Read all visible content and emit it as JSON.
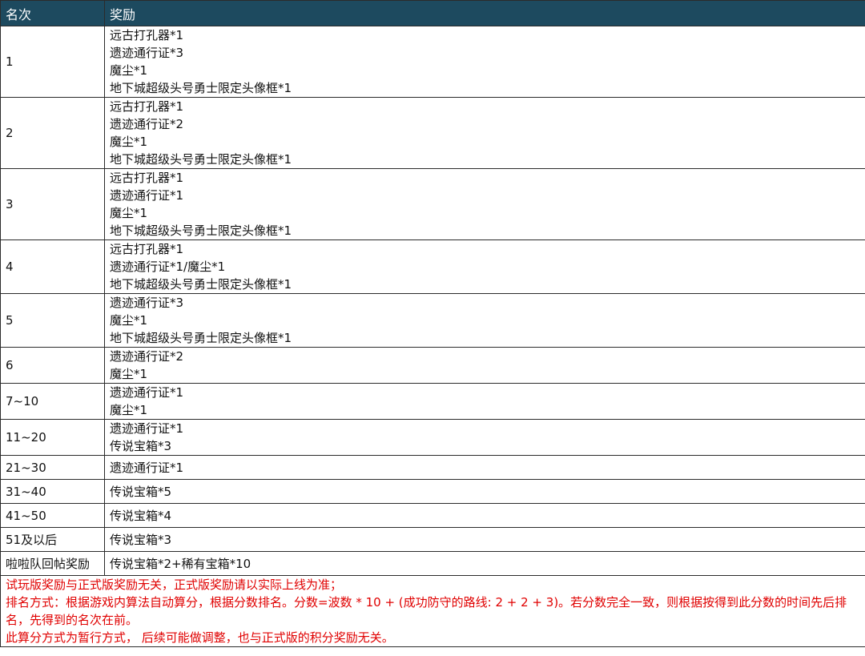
{
  "table": {
    "headers": {
      "rank": "名次",
      "reward": "奖励"
    },
    "rows": [
      {
        "rank": "1",
        "rewards": [
          "远古打孔器*1",
          "遗迹通行证*3",
          "魔尘*1",
          "地下城超级头号勇士限定头像框*1"
        ]
      },
      {
        "rank": "2",
        "rewards": [
          "远古打孔器*1",
          "遗迹通行证*2",
          "魔尘*1",
          "地下城超级头号勇士限定头像框*1"
        ]
      },
      {
        "rank": "3",
        "rewards": [
          "远古打孔器*1",
          "遗迹通行证*1",
          "魔尘*1",
          "地下城超级头号勇士限定头像框*1"
        ]
      },
      {
        "rank": "4",
        "rewards": [
          "远古打孔器*1",
          "遗迹通行证*1/魔尘*1",
          "地下城超级头号勇士限定头像框*1"
        ]
      },
      {
        "rank": "5",
        "rewards": [
          "遗迹通行证*3",
          "魔尘*1",
          "地下城超级头号勇士限定头像框*1"
        ]
      },
      {
        "rank": "6",
        "rewards": [
          "遗迹通行证*2",
          "魔尘*1"
        ]
      },
      {
        "rank": "7~10",
        "rewards": [
          "遗迹通行证*1",
          "魔尘*1"
        ]
      },
      {
        "rank": "11~20",
        "rewards": [
          "遗迹通行证*1",
          "传说宝箱*3"
        ]
      },
      {
        "rank": "21~30",
        "rewards": [
          "遗迹通行证*1"
        ]
      },
      {
        "rank": "31~40",
        "rewards": [
          "传说宝箱*5"
        ]
      },
      {
        "rank": "41~50",
        "rewards": [
          "传说宝箱*4"
        ]
      },
      {
        "rank": "51及以后",
        "rewards": [
          "传说宝箱*3"
        ]
      },
      {
        "rank": "啦啦队回帖奖励",
        "rewards": [
          "传说宝箱*2+稀有宝箱*10"
        ]
      }
    ],
    "notes": [
      "试玩版奖励与正式版奖励无关，正式版奖励请以实际上线为准；",
      "排名方式：根据游戏内算法自动算分，根据分数排名。分数=波数 * 10 + (成功防守的路线: 2 + 2 + 3)。若分数完全一致，则根据按得到此分数的时间先后排名，先得到的名次在前。",
      "此算分方式为暂行方式， 后续可能做调整，也与正式版的积分奖励无关。"
    ]
  },
  "colors": {
    "header_bg": "#1d4a5f",
    "header_text": "#ffffff",
    "note_text": "#e00000",
    "border": "#2b2b2b"
  }
}
